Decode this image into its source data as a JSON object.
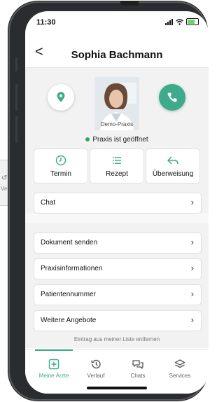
{
  "status_bar": {
    "time": "11:30"
  },
  "header": {
    "back_label": "<",
    "title": "Sophia Bachmann"
  },
  "profile": {
    "photo_watermark": "Demo-Praxis",
    "open_status": "Praxis ist geöffnet"
  },
  "actions": [
    {
      "label": "Termin",
      "icon": "clock-icon"
    },
    {
      "label": "Rezept",
      "icon": "list-icon"
    },
    {
      "label": "Überweisung",
      "icon": "reply-arrow-icon"
    }
  ],
  "chat_label": "Chat",
  "menu_items": [
    {
      "label": "Dokument senden"
    },
    {
      "label": "Praxisinformationen"
    },
    {
      "label": "Patientennummer"
    },
    {
      "label": "Weitere Angebote"
    }
  ],
  "remove_link": "Eintrag aus meiner Liste entfernen",
  "tabs": [
    {
      "label": "Meine Ärzte",
      "icon": "plus-square-icon",
      "active": true
    },
    {
      "label": "Verlauf",
      "icon": "history-icon",
      "active": false
    },
    {
      "label": "Chats",
      "icon": "chat-bubbles-icon",
      "active": false
    },
    {
      "label": "Services",
      "icon": "layers-icon",
      "active": false
    }
  ],
  "background_app": {
    "label": "Verl"
  },
  "colors": {
    "accent": "#3dab8c",
    "open_dot": "#2eaa5c",
    "background": "#f2f2f2"
  }
}
